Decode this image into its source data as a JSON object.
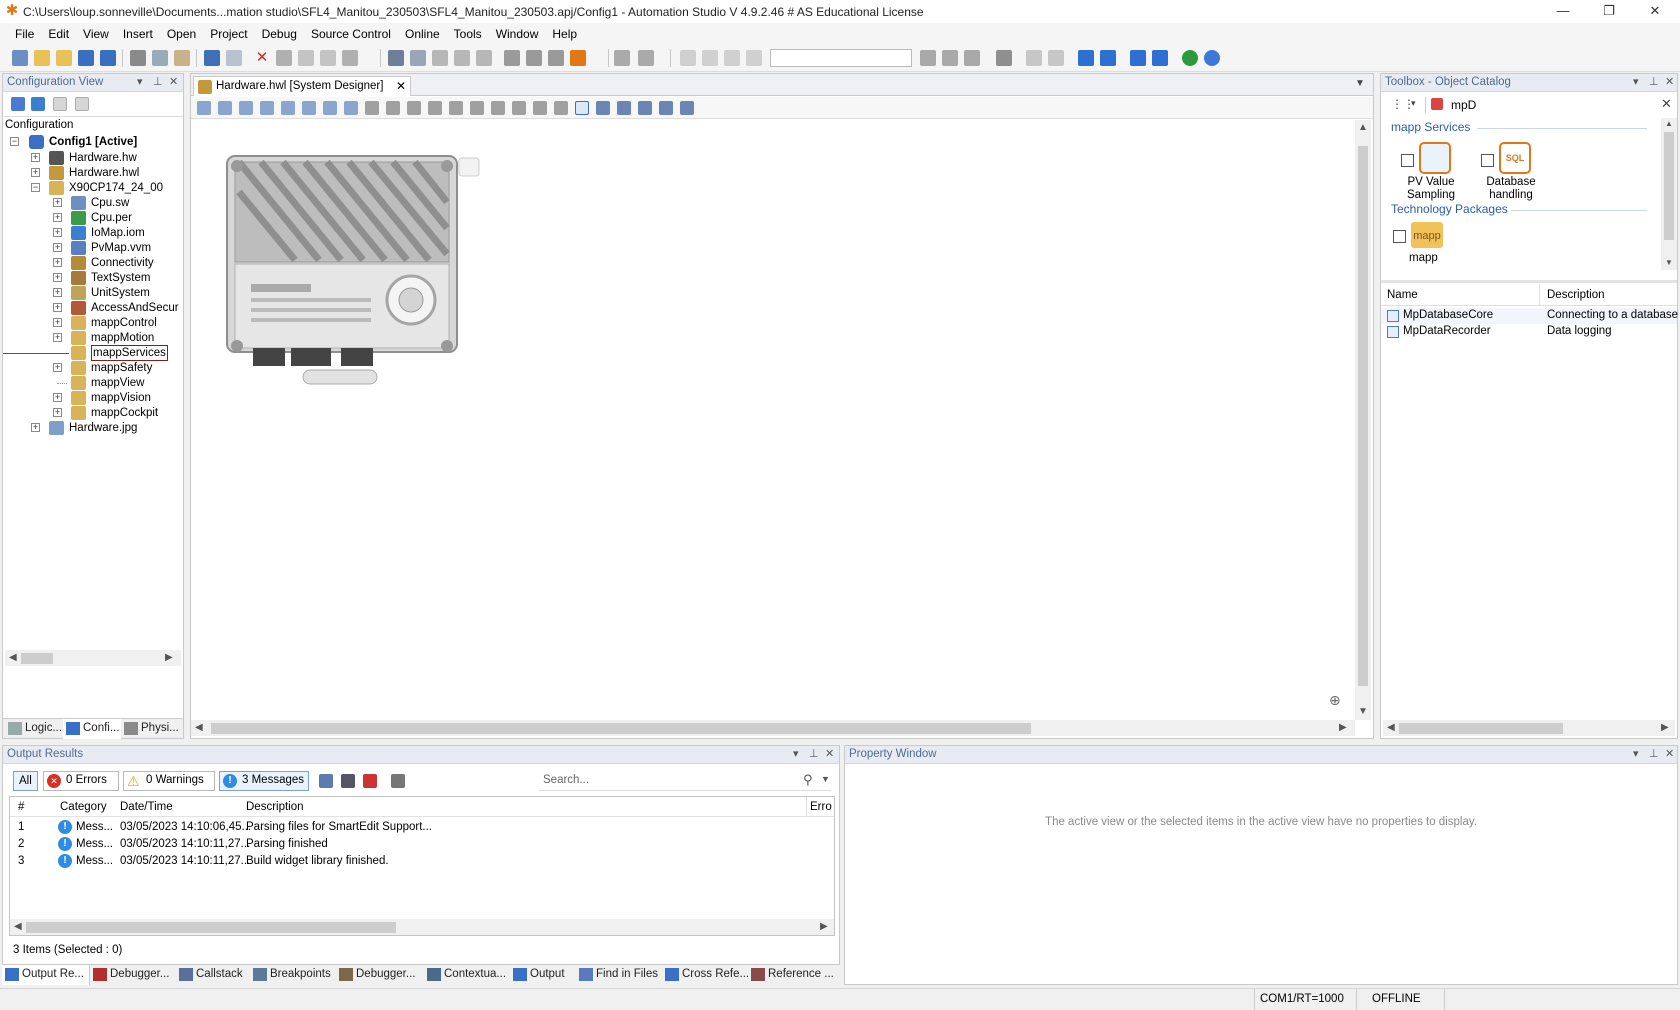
{
  "window": {
    "title": "C:\\Users\\loup.sonneville\\Documents...mation studio\\SFL4_Manitou_230503\\SFL4_Manitou_230503.apj/Config1 - Automation Studio V 4.9.2.46 # AS Educational License",
    "minimize": "—",
    "restore": "❐",
    "close": "✕"
  },
  "menu": [
    "File",
    "Edit",
    "View",
    "Insert",
    "Open",
    "Project",
    "Debug",
    "Source Control",
    "Online",
    "Tools",
    "Window",
    "Help"
  ],
  "config_view": {
    "title": "Configuration View",
    "root_label": "Configuration",
    "config_name": "Config1 [Active]",
    "items": [
      {
        "label": "Hardware.hw",
        "level": 1
      },
      {
        "label": "Hardware.hwl",
        "level": 1
      },
      {
        "label": "X90CP174_24_00",
        "level": 1
      },
      {
        "label": "Cpu.sw",
        "level": 2
      },
      {
        "label": "Cpu.per",
        "level": 2
      },
      {
        "label": "IoMap.iom",
        "level": 2
      },
      {
        "label": "PvMap.vvm",
        "level": 2
      },
      {
        "label": "Connectivity",
        "level": 2
      },
      {
        "label": "TextSystem",
        "level": 2
      },
      {
        "label": "UnitSystem",
        "level": 2
      },
      {
        "label": "AccessAndSecur",
        "level": 2
      },
      {
        "label": "mappControl",
        "level": 2
      },
      {
        "label": "mappMotion",
        "level": 2
      },
      {
        "label": "mappServices",
        "level": 2
      },
      {
        "label": "mappSafety",
        "level": 2
      },
      {
        "label": "mappView",
        "level": 2
      },
      {
        "label": "mappVision",
        "level": 2
      },
      {
        "label": "mappCockpit",
        "level": 2
      },
      {
        "label": "Hardware.jpg",
        "level": 1
      }
    ],
    "tabs": [
      "Logic...",
      "Confi...",
      "Physi..."
    ]
  },
  "designer": {
    "tab_label": "Hardware.hwl [System Designer]"
  },
  "toolbox": {
    "title": "Toolbox - Object Catalog",
    "search_value": "mpD",
    "group1": "mapp Services",
    "item1_line1": "PV Value",
    "item1_line2": "Sampling",
    "item2_line1": "Database",
    "item2_line2": "handling",
    "sql_badge": "SQL",
    "group2": "Technology Packages",
    "item3": "mapp",
    "item3_badge": "mapp",
    "col_name": "Name",
    "col_desc": "Description",
    "rows": [
      {
        "name": "MpDatabaseCore",
        "desc": "Connecting to a database"
      },
      {
        "name": "MpDataRecorder",
        "desc": "Data logging"
      }
    ]
  },
  "output": {
    "title": "Output Results",
    "filter_all": "All",
    "filter_errors": "0 Errors",
    "filter_warnings": "0 Warnings",
    "filter_messages": "3 Messages",
    "search_placeholder": "Search...",
    "columns": [
      "#",
      "Category",
      "Date/Time",
      "Description",
      "Erro"
    ],
    "rows": [
      {
        "num": "1",
        "cat": "Mess...",
        "time": "03/05/2023 14:10:06,45...",
        "desc": "Parsing files for SmartEdit Support..."
      },
      {
        "num": "2",
        "cat": "Mess...",
        "time": "03/05/2023 14:10:11,27...",
        "desc": "Parsing finished"
      },
      {
        "num": "3",
        "cat": "Mess...",
        "time": "03/05/2023 14:10:11,27...",
        "desc": "Build widget library finished."
      }
    ],
    "footer": "3 Items (Selected : 0)"
  },
  "property_window": {
    "title": "Property Window",
    "empty_message": "The active view or the selected items in the active view have no properties to display."
  },
  "bottom_tabs": [
    "Output Re...",
    "Debugger...",
    "Callstack",
    "Breakpoints",
    "Debugger...",
    "Contextua...",
    "Output",
    "Find in Files",
    "Cross Refe...",
    "Reference ..."
  ],
  "status": {
    "com": "COM1/RT=1000",
    "mode": "OFFLINE"
  },
  "colors": {
    "panel_title_bg": "#e8ecf2",
    "panel_title_text": "#4d6b90",
    "accent_blue": "#1f5fbf",
    "orange": "#e07818",
    "selection": "#cce4f7"
  }
}
